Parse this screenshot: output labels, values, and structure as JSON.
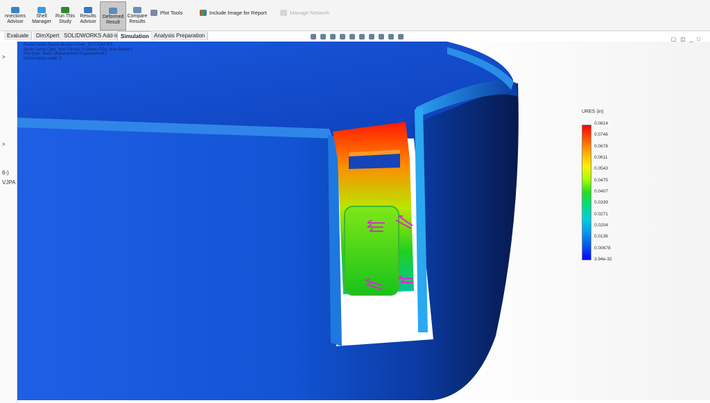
{
  "ribbon": {
    "buttons": [
      {
        "label": "nnections\nAdvisor",
        "color": "#3d7fc8"
      },
      {
        "label": "Shell\nManager",
        "color": "#3b9adf"
      },
      {
        "label": "Run This\nStudy",
        "color": "#2f8a2f"
      },
      {
        "label": "Results\nAdvisor",
        "color": "#3a76c2"
      },
      {
        "label": "Deformed\nResult",
        "color": "#5e8ab6",
        "active": true
      },
      {
        "label": "Compare\nResults",
        "color": "#6c8fb8"
      }
    ],
    "plot_tools_label": "Plot Tools",
    "include_image_label": "Include Image for Report",
    "manage_network_label": "Manage Network"
  },
  "tabs": [
    {
      "label": "Evaluate"
    },
    {
      "label": "DimXpert"
    },
    {
      "label": "SOLIDWORKS Add-Ins"
    },
    {
      "label": "Simulation",
      "active": true
    },
    {
      "label": "Analysis Preparation"
    }
  ],
  "left_strip": {
    "chevron_a": ">",
    "chevron_b": ">",
    "label_a": "6-)",
    "label_b": "VJPA"
  },
  "hud": {
    "line1": "Model name:Space Mouse Cover_BOTTOM RS",
    "line2": "Study name:Clips_Non Flexed Positions-FEA_Non flexed-)",
    "line3": "Plot type: Static displacement Displacement1",
    "line4": "Deformation scale: 1"
  },
  "legend": {
    "title": "URES (in)",
    "ticks": [
      "0.0814",
      "0.0746",
      "0.0678",
      "0.0611",
      "0.0543",
      "0.0475",
      "0.0407",
      "0.0339",
      "0.0271",
      "0.0204",
      "0.0136",
      "0.00678",
      "3.94e-32"
    ]
  },
  "colors": {
    "accent": "#0050e0"
  }
}
